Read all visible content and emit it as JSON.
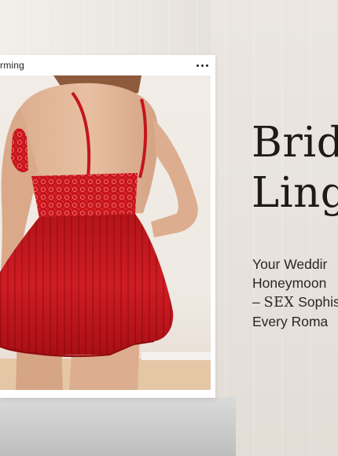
{
  "post": {
    "username": "rming",
    "more_icon": "more-horizontal-icon"
  },
  "headline": {
    "line1": "Brid",
    "line2": "Ling"
  },
  "tagline": {
    "line1": "Your Weddir",
    "line2": "Honeymoon",
    "line3_dash": "–",
    "line3_badge": "SEX",
    "line3_rest": "Sophis",
    "line4": "Every Roma"
  },
  "colors": {
    "garment_red": "#c4161c",
    "text_dark": "#1e1a17"
  }
}
